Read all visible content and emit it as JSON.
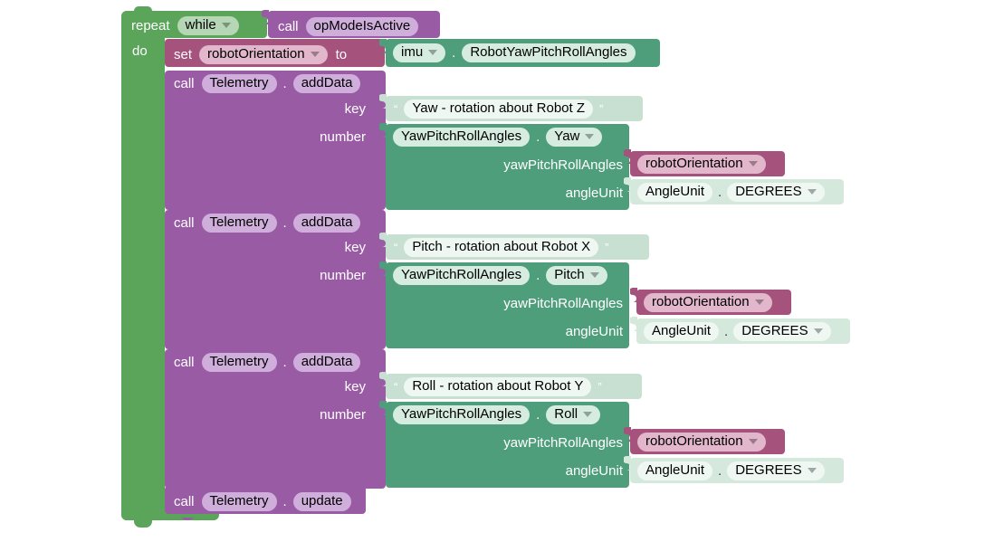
{
  "app": {
    "kind": "blockly-workspace",
    "title": "FTC Blocks program"
  },
  "colors": {
    "control_green": "#5ba55b",
    "telemetry_purple": "#9a5ba5",
    "variable_maroon": "#a5527d",
    "imu_teal": "#4f9e7b",
    "text_mint": "#c7e0d2",
    "enum_mint_light": "#d5e8dc"
  },
  "program": {
    "repeat": {
      "repeat_label": "repeat",
      "mode": "while",
      "do_label": "do",
      "condition": {
        "call_label": "call",
        "method": "opModeIsActive"
      }
    },
    "set_variable": {
      "set_label": "set",
      "variable": "robotOrientation",
      "to_label": "to",
      "value": {
        "object": "imu",
        "dot": ".",
        "property": "RobotYawPitchRollAngles"
      }
    },
    "telemetry_calls": [
      {
        "call_label": "call",
        "object": "Telemetry",
        "dot": ".",
        "method": "addData",
        "key_label": "key",
        "key_quote_open": "“",
        "key_quote_close": "”",
        "key_value": "Yaw - rotation about Robot Z",
        "number_label": "number",
        "number_class": "YawPitchRollAngles",
        "number_dot": ".",
        "number_member": "Yaw",
        "arg1_label": "yawPitchRollAngles",
        "arg1_value": "robotOrientation",
        "arg2_label": "angleUnit",
        "arg2_class": "AngleUnit",
        "arg2_dot": ".",
        "arg2_value": "DEGREES"
      },
      {
        "call_label": "call",
        "object": "Telemetry",
        "dot": ".",
        "method": "addData",
        "key_label": "key",
        "key_quote_open": "“",
        "key_quote_close": "”",
        "key_value": "Pitch - rotation about Robot X",
        "number_label": "number",
        "number_class": "YawPitchRollAngles",
        "number_dot": ".",
        "number_member": "Pitch",
        "arg1_label": "yawPitchRollAngles",
        "arg1_value": "robotOrientation",
        "arg2_label": "angleUnit",
        "arg2_class": "AngleUnit",
        "arg2_dot": ".",
        "arg2_value": "DEGREES"
      },
      {
        "call_label": "call",
        "object": "Telemetry",
        "dot": ".",
        "method": "addData",
        "key_label": "key",
        "key_quote_open": "“",
        "key_quote_close": "”",
        "key_value": "Roll - rotation about Robot Y",
        "number_label": "number",
        "number_class": "YawPitchRollAngles",
        "number_dot": ".",
        "number_member": "Roll",
        "arg1_label": "yawPitchRollAngles",
        "arg1_value": "robotOrientation",
        "arg2_label": "angleUnit",
        "arg2_class": "AngleUnit",
        "arg2_dot": ".",
        "arg2_value": "DEGREES"
      }
    ],
    "telemetry_update": {
      "call_label": "call",
      "object": "Telemetry",
      "dot": ".",
      "method": "update"
    }
  }
}
